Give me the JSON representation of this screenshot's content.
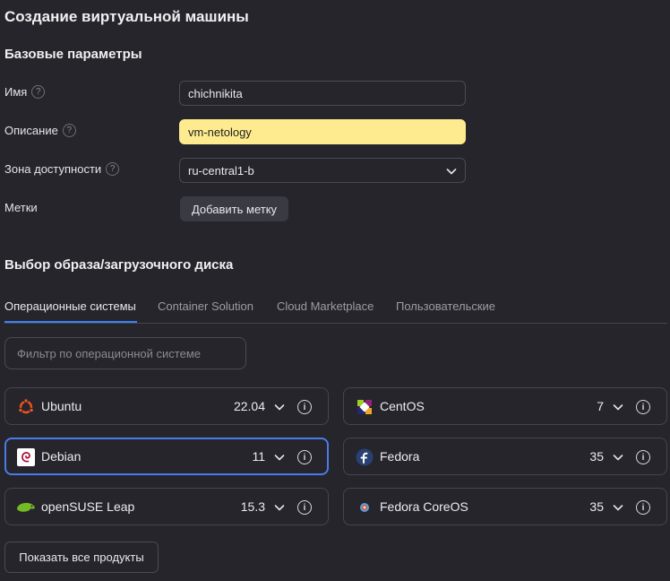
{
  "page": {
    "title": "Создание виртуальной машины"
  },
  "basic": {
    "section_title": "Базовые параметры",
    "name": {
      "label": "Имя",
      "value": "chichnikita"
    },
    "description": {
      "label": "Описание",
      "value": "vm-netology"
    },
    "zone": {
      "label": "Зона доступности",
      "value": "ru-central1-b"
    },
    "tags": {
      "label": "Метки",
      "button": "Добавить метку"
    },
    "help_glyph": "?"
  },
  "image": {
    "section_title": "Выбор образа/загрузочного диска",
    "tabs": [
      {
        "label": "Операционные системы",
        "active": true
      },
      {
        "label": "Container Solution",
        "active": false
      },
      {
        "label": "Cloud Marketplace",
        "active": false
      },
      {
        "label": "Пользовательские",
        "active": false
      }
    ],
    "filter_placeholder": "Фильтр по операционной системе",
    "os_list": [
      {
        "name": "Ubuntu",
        "version": "22.04",
        "icon": "ubuntu-icon",
        "selected": false
      },
      {
        "name": "CentOS",
        "version": "7",
        "icon": "centos-icon",
        "selected": false
      },
      {
        "name": "Debian",
        "version": "11",
        "icon": "debian-icon",
        "selected": true
      },
      {
        "name": "Fedora",
        "version": "35",
        "icon": "fedora-icon",
        "selected": false
      },
      {
        "name": "openSUSE Leap",
        "version": "15.3",
        "icon": "opensuse-icon",
        "selected": false
      },
      {
        "name": "Fedora CoreOS",
        "version": "35",
        "icon": "fedora-coreos-icon",
        "selected": false
      }
    ],
    "show_all_button": "Показать все продукты"
  },
  "colors": {
    "background": "#25252b",
    "highlight_field": "#ffeb8f",
    "accent": "#3b82f6",
    "ubuntu": "#e95420",
    "debian": "#a80030",
    "fedora": "#294172",
    "opensuse": "#73ba25"
  }
}
